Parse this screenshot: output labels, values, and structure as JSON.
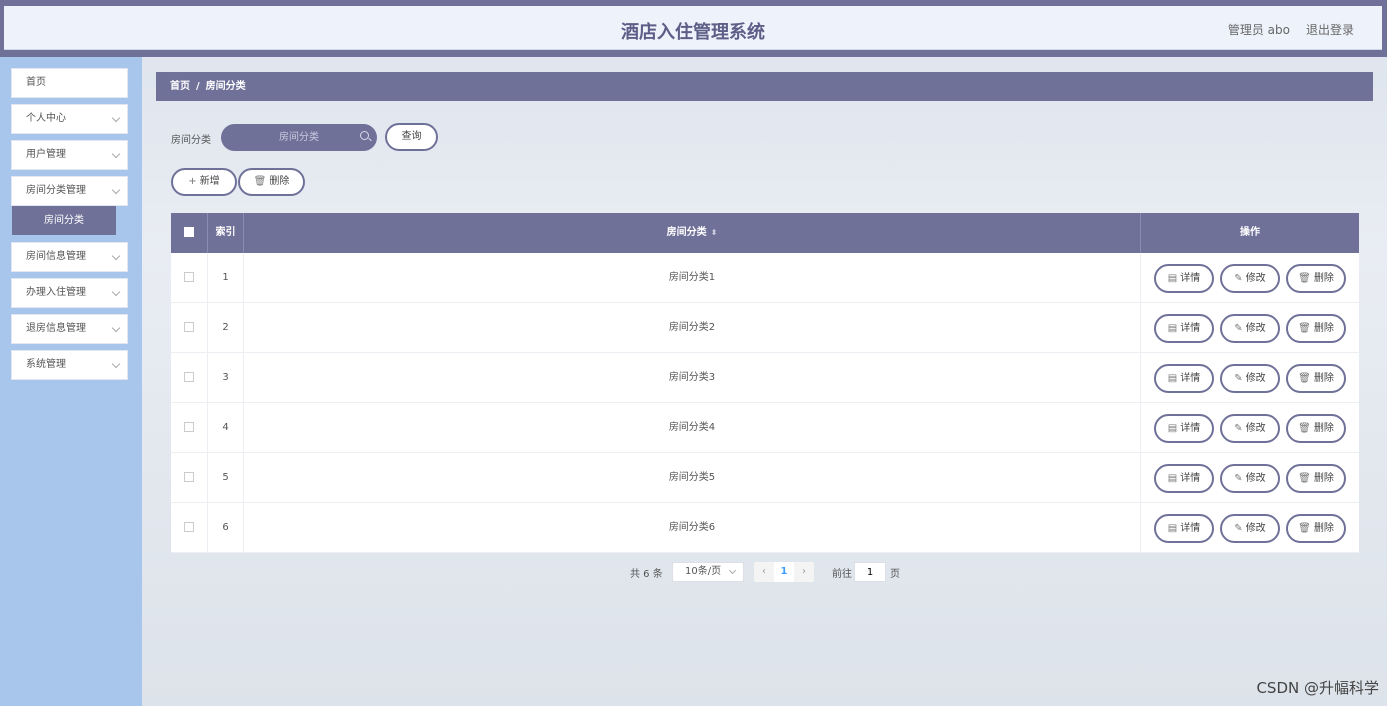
{
  "header": {
    "title": "酒店入住管理系统",
    "user": "管理员 abo",
    "logout": "退出登录"
  },
  "sidebar": {
    "items": [
      {
        "label": "首页"
      },
      {
        "label": "个人中心"
      },
      {
        "label": "用户管理"
      },
      {
        "label": "房间分类管理"
      },
      {
        "label": "房间信息管理"
      },
      {
        "label": "办理入住管理"
      },
      {
        "label": "退房信息管理"
      },
      {
        "label": "系统管理"
      }
    ],
    "active_sub": "房间分类"
  },
  "breadcrumb": {
    "home": "首页",
    "sep": "/",
    "current": "房间分类"
  },
  "search": {
    "label": "房间分类",
    "placeholder": "房间分类",
    "button": "查询"
  },
  "toolbar": {
    "add": "新增",
    "delete": "删除"
  },
  "table": {
    "headers": {
      "index": "索引",
      "category": "房间分类",
      "actions": "操作"
    },
    "rows": [
      {
        "index": "1",
        "category": "房间分类1"
      },
      {
        "index": "2",
        "category": "房间分类2"
      },
      {
        "index": "3",
        "category": "房间分类3"
      },
      {
        "index": "4",
        "category": "房间分类4"
      },
      {
        "index": "5",
        "category": "房间分类5"
      },
      {
        "index": "6",
        "category": "房间分类6"
      }
    ],
    "actions": {
      "detail": "详情",
      "edit": "修改",
      "delete": "删除"
    }
  },
  "pagination": {
    "total": "共 6 条",
    "page_size": "10条/页",
    "current": "1",
    "goto": "前往",
    "goto_value": "1",
    "page_unit": "页"
  },
  "watermark": "CSDN @升幅科学"
}
